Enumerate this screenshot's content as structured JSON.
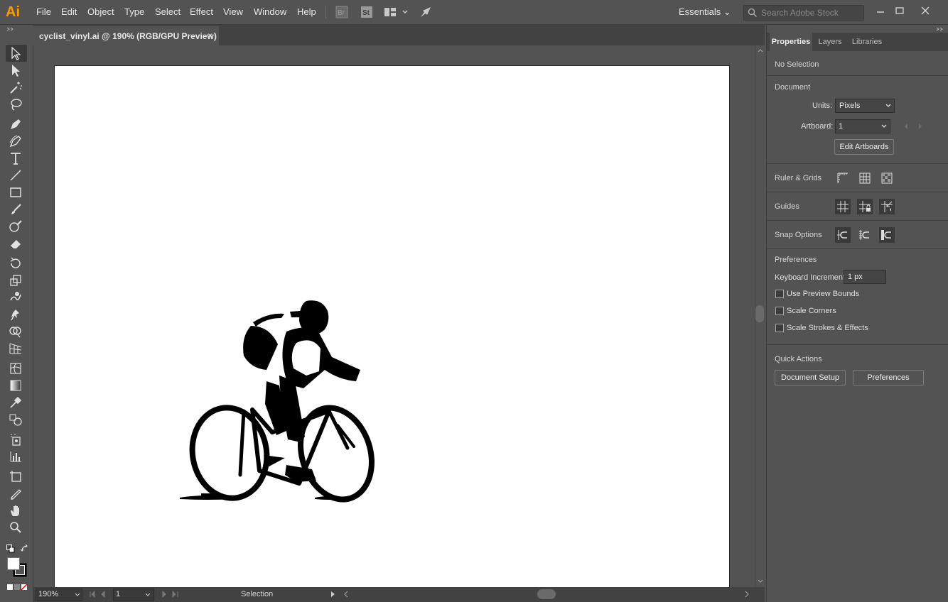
{
  "app": {
    "logo": "Ai"
  },
  "menu": [
    "File",
    "Edit",
    "Object",
    "Type",
    "Select",
    "Effect",
    "View",
    "Window",
    "Help"
  ],
  "workspace": {
    "label": "Essentials"
  },
  "search": {
    "placeholder": "Search Adobe Stock"
  },
  "document_tab": {
    "title": "cyclist_vinyl.ai @ 190% (RGB/GPU Preview)",
    "close": "×"
  },
  "status_bar": {
    "zoom": "190%",
    "artboard": "1",
    "tool": "Selection"
  },
  "panel": {
    "tabs": [
      "Properties",
      "Layers",
      "Libraries"
    ],
    "selection_state": "No Selection",
    "document": {
      "title": "Document",
      "units_label": "Units:",
      "units_value": "Pixels",
      "artboard_label": "Artboard:",
      "artboard_value": "1",
      "edit_artboards": "Edit Artboards"
    },
    "ruler_grids": "Ruler & Grids",
    "guides": "Guides",
    "snap_options": "Snap Options",
    "preferences": {
      "title": "Preferences",
      "keyboard_increment_label": "Keyboard Increment:",
      "keyboard_increment_value": "1 px",
      "checkboxes": [
        "Use Preview Bounds",
        "Scale Corners",
        "Scale Strokes & Effects"
      ]
    },
    "quick_actions": {
      "title": "Quick Actions",
      "document_setup": "Document Setup",
      "preferences": "Preferences"
    }
  },
  "colors": {
    "accent_logo": "#ff9a00",
    "ui_bg": "#535353",
    "artboard": "#ffffff"
  }
}
